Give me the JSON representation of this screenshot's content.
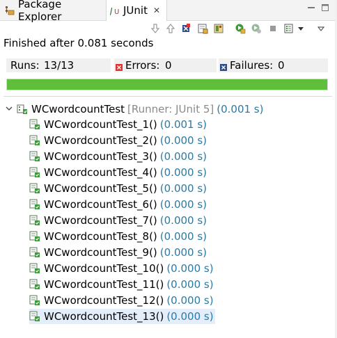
{
  "tabs": [
    {
      "label": "Package Explorer",
      "icon": "package-explorer-icon",
      "active": false
    },
    {
      "label": "JUnit",
      "icon": "junit-icon",
      "active": true,
      "close": "✕"
    }
  ],
  "toolbar": [
    "next-failure-icon",
    "previous-failure-icon",
    "show-failures-only-icon",
    "scroll-lock-icon",
    "layout-icon",
    "rerun-icon",
    "rerun-failed-icon",
    "stop-icon",
    "history-icon",
    "view-menu-icon"
  ],
  "status": "Finished after 0.081 seconds",
  "counters": {
    "runs_label": "Runs:",
    "runs_value": "13/13",
    "errors_label": "Errors:",
    "errors_value": "0",
    "failures_label": "Failures:",
    "failures_value": "0"
  },
  "progress": {
    "fraction": 1.0,
    "color": "#5fbf3a"
  },
  "tree": {
    "root": {
      "name": "WCwordcountTest",
      "runner": "[Runner: JUnit 5]",
      "time": "(0.001 s)"
    },
    "items": [
      {
        "name": "WCwordcountTest_1()",
        "time": "(0.001 s)"
      },
      {
        "name": "WCwordcountTest_2()",
        "time": "(0.000 s)"
      },
      {
        "name": "WCwordcountTest_3()",
        "time": "(0.000 s)"
      },
      {
        "name": "WCwordcountTest_4()",
        "time": "(0.000 s)"
      },
      {
        "name": "WCwordcountTest_5()",
        "time": "(0.000 s)"
      },
      {
        "name": "WCwordcountTest_6()",
        "time": "(0.000 s)"
      },
      {
        "name": "WCwordcountTest_7()",
        "time": "(0.000 s)"
      },
      {
        "name": "WCwordcountTest_8()",
        "time": "(0.000 s)"
      },
      {
        "name": "WCwordcountTest_9()",
        "time": "(0.000 s)"
      },
      {
        "name": "WCwordcountTest_10()",
        "time": "(0.000 s)"
      },
      {
        "name": "WCwordcountTest_11()",
        "time": "(0.000 s)"
      },
      {
        "name": "WCwordcountTest_12()",
        "time": "(0.000 s)"
      },
      {
        "name": "WCwordcountTest_13()",
        "time": "(0.000 s)",
        "selected": true
      }
    ]
  }
}
